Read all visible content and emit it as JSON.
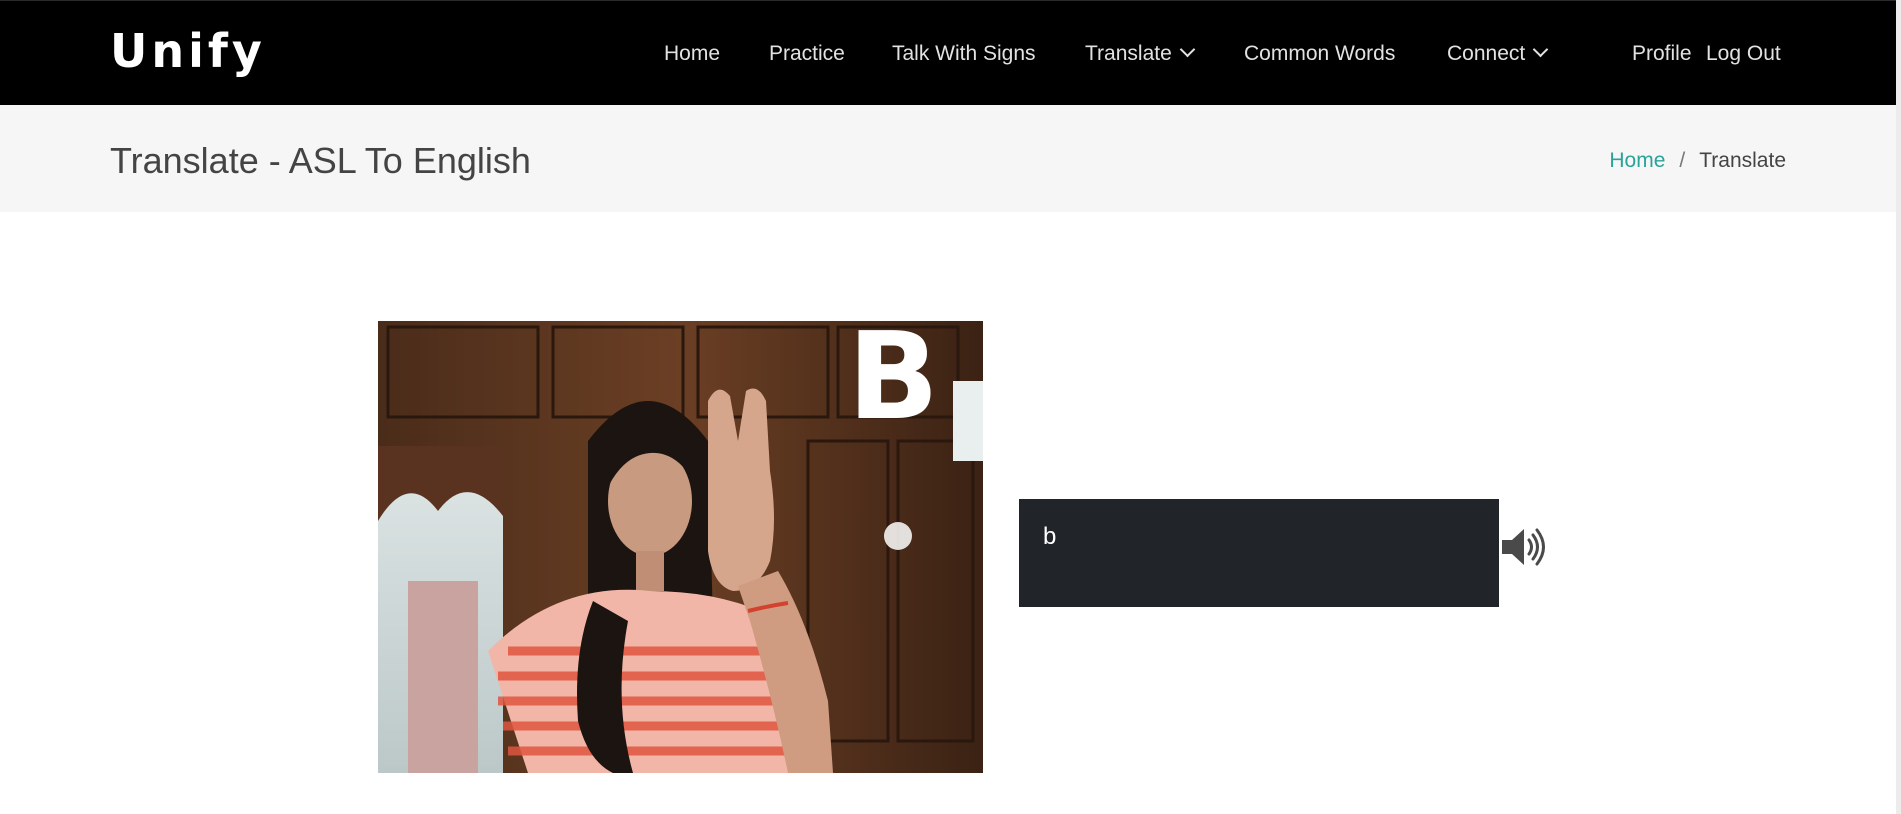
{
  "app": {
    "brand": "Unify"
  },
  "nav": {
    "items": [
      {
        "label": "Home"
      },
      {
        "label": "Practice"
      },
      {
        "label": "Talk With Signs"
      },
      {
        "label": "Translate"
      },
      {
        "label": "Common Words"
      },
      {
        "label": "Connect"
      },
      {
        "label": "Profile"
      },
      {
        "label": "Log Out"
      }
    ]
  },
  "header": {
    "title": "Translate - ASL To English",
    "breadcrumb": {
      "home": "Home",
      "separator": "/",
      "current": "Translate"
    }
  },
  "camera": {
    "detected_letter": "B"
  },
  "output": {
    "text": "b"
  },
  "icons": {
    "translate_dropdown": "chevron-down-icon",
    "connect_dropdown": "chevron-down-icon",
    "speak": "speaker-icon"
  },
  "colors": {
    "navbar_bg": "#000000",
    "title_bg": "#f6f6f6",
    "breadcrumb_link": "#2aa39a",
    "output_bg": "#212529"
  }
}
